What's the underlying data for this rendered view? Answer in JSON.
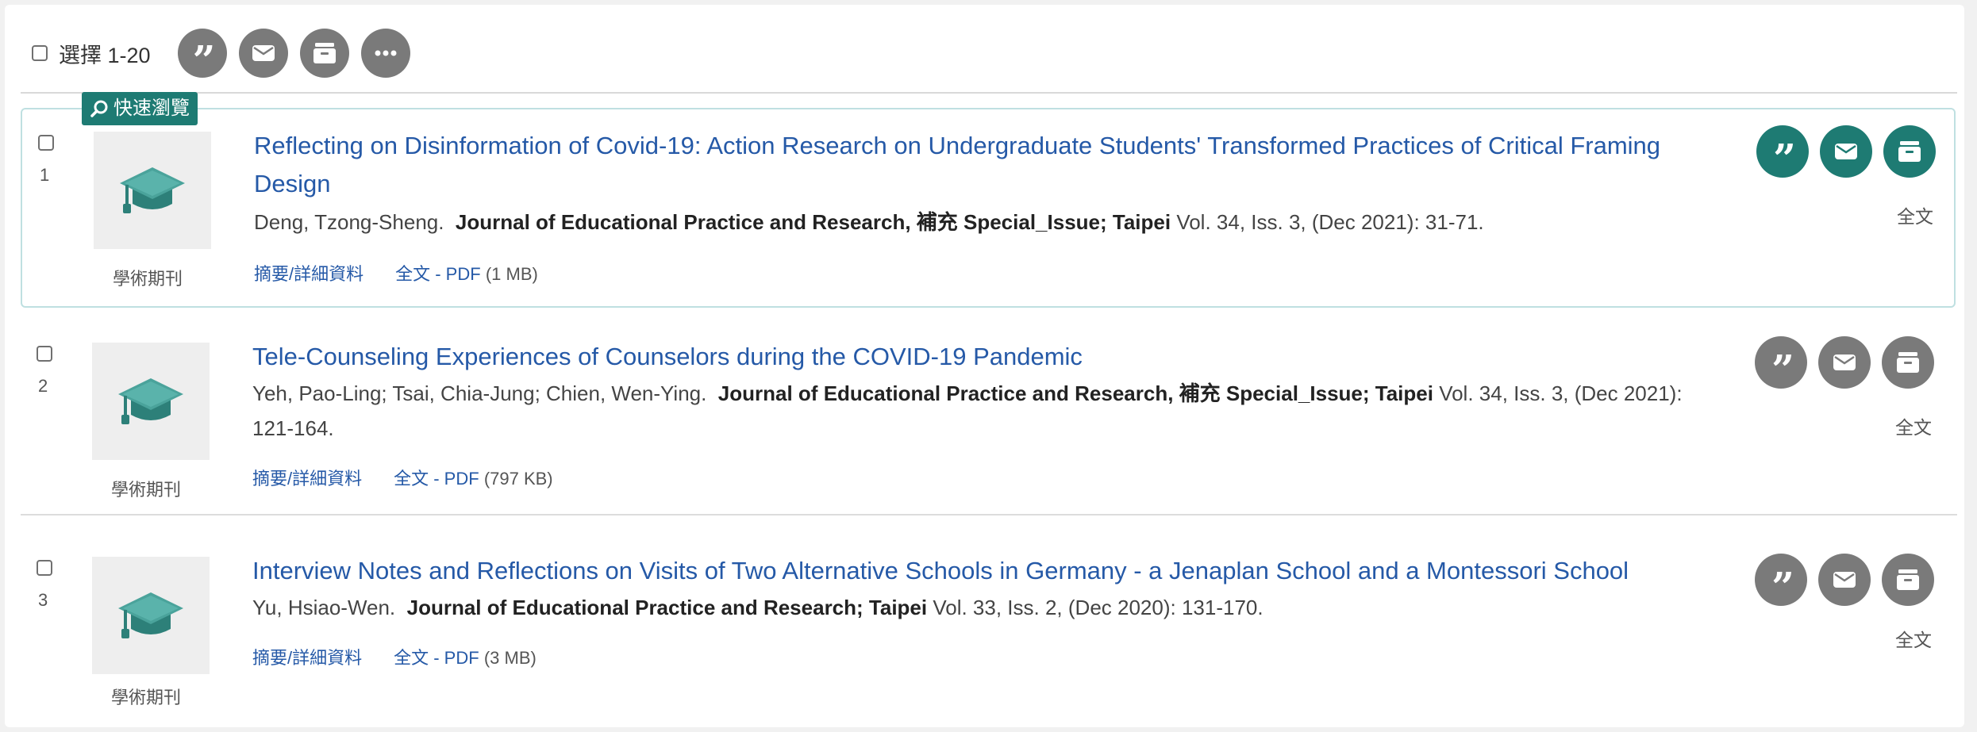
{
  "toolbar": {
    "select_label": "選擇 1-20",
    "icons": [
      "quote-icon",
      "email-icon",
      "save-icon",
      "more-icon"
    ]
  },
  "quick_view": {
    "label": "快速瀏覽",
    "icon": "zoom-icon"
  },
  "results": [
    {
      "number": "1",
      "type": "學術期刊",
      "title_line1": "Reflecting on Disinformation of Covid-19: Action Research on Undergraduate Students' Transformed Practices of Critical Framing",
      "title_line2": "Design",
      "authors": "Deng, Tzong-Sheng.",
      "journal": "Journal of Educational Practice and Research, 補充 Special_Issue; Taipei",
      "details": "Vol. 34, Iss. 3,  (Dec 2021): 31-71.",
      "details2": "",
      "abstract_link": "摘要/詳細資料",
      "fulltext_link": "全文 - PDF",
      "fulltext_size": "(1 MB)",
      "fulltext_label": "全文",
      "highlighted": true
    },
    {
      "number": "2",
      "type": "學術期刊",
      "title_line1": "Tele-Counseling Experiences of Counselors during the COVID-19 Pandemic",
      "title_line2": "",
      "authors": "Yeh, Pao-Ling; Tsai, Chia-Jung; Chien, Wen-Ying.",
      "journal": "Journal of Educational Practice and Research, 補充 Special_Issue; Taipei",
      "details": "Vol. 34, Iss. 3,  (Dec 2021):",
      "details2": "121-164.",
      "abstract_link": "摘要/詳細資料",
      "fulltext_link": "全文 - PDF",
      "fulltext_size": "(797 KB)",
      "fulltext_label": "全文",
      "highlighted": false
    },
    {
      "number": "3",
      "type": "學術期刊",
      "title_line1": "Interview Notes and Reflections on Visits of Two Alternative Schools in Germany - a Jenaplan School and a Montessori School",
      "title_line2": "",
      "authors": "Yu, Hsiao-Wen.",
      "journal": "Journal of Educational Practice and Research; Taipei",
      "details": "Vol. 33, Iss. 2,  (Dec 2020): 131-170.",
      "details2": "",
      "abstract_link": "摘要/詳細資料",
      "fulltext_link": "全文 - PDF",
      "fulltext_size": "(3 MB)",
      "fulltext_label": "全文",
      "highlighted": false
    }
  ],
  "colors": {
    "accent": "#1e7b73",
    "link": "#2559a7",
    "icon_gray": "#7a7a7a",
    "highlight_border": "#bfe0e1"
  }
}
